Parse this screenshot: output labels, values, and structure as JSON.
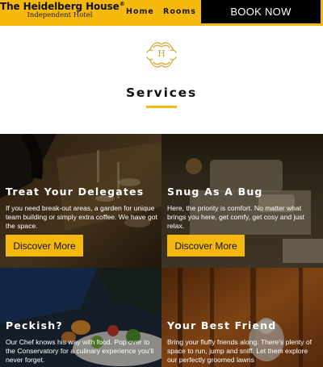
{
  "header": {
    "brand_name": "The Heidelberg House",
    "brand_mark": "®",
    "brand_sub": "Independent Hotel",
    "nav": [
      "Home",
      "Rooms"
    ],
    "book_label": "BOOK NOW"
  },
  "emblem": {
    "letter": "H",
    "icon": "hotel-crest-icon"
  },
  "services": {
    "title": "Services"
  },
  "tiles": [
    {
      "title": "Treat Your Delegates",
      "text": "If you need break-out areas, a garden for unique team building or simply extra coffee. We have got the space.",
      "button": "Discover More"
    },
    {
      "title": "Snug As A Bug",
      "text": "Here, the priority is comfort. No matter what brings you here, get comfy, get cosy and just relax.",
      "button": "Discover More"
    },
    {
      "title": "Peckish?",
      "text": "Our Chef knows his way with food. Pop over to the Conservatory for a culinary experience you'll never forget."
    },
    {
      "title": "Your Best Friend",
      "text": "Bring your fluffy friends along. There's plenty of space to run, jump and sniff. Let them explore our perfectly groomed lawns"
    }
  ],
  "colors": {
    "accent": "#f5b80d",
    "book_bg": "#000000"
  }
}
